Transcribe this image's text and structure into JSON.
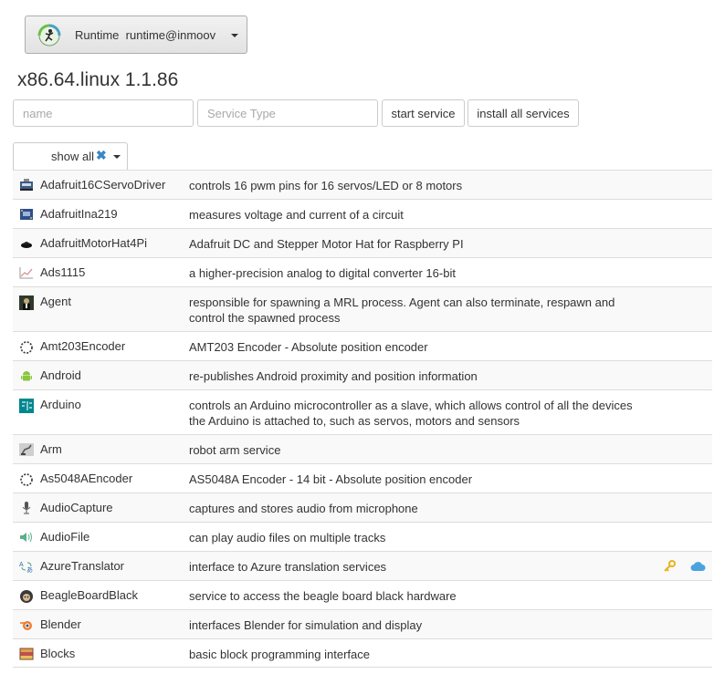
{
  "runtime": {
    "label": "Runtime",
    "instance": "runtime@inmoov",
    "logo_icon": "runtime-logo-icon"
  },
  "platform": "x86.64.linux 1.1.86",
  "filters": {
    "name_placeholder": "name",
    "type_placeholder": "Service Type",
    "start_label": "start service",
    "install_label": "install all services",
    "show_label": "show all",
    "clear_symbol": "✖"
  },
  "colors": {
    "accent_blue": "#3a87c8",
    "key_gold": "#e8b21a",
    "cloud_blue": "#4aa3df",
    "row_border": "#dddddd",
    "row_shade": "#f9f9f9"
  },
  "services": [
    {
      "name": "Adafruit16CServoDriver",
      "description": "controls 16 pwm pins for 16 servos/LED or 8 motors",
      "icon": "servo-driver-board-icon"
    },
    {
      "name": "AdafruitIna219",
      "description": "measures voltage and current of a circuit",
      "icon": "ina219-board-icon"
    },
    {
      "name": "AdafruitMotorHat4Pi",
      "description": "Adafruit DC and Stepper Motor Hat for Raspberry PI",
      "icon": "motor-hat-icon"
    },
    {
      "name": "Ads1115",
      "description": "a higher-precision analog to digital converter 16-bit",
      "icon": "analog-chart-icon"
    },
    {
      "name": "Agent",
      "description": "responsible for spawning a MRL process. Agent can also terminate, respawn and control the spawned process",
      "icon": "agent-icon"
    },
    {
      "name": "Amt203Encoder",
      "description": "AMT203 Encoder - Absolute position encoder",
      "icon": "encoder-ring-icon"
    },
    {
      "name": "Android",
      "description": "re-publishes Android proximity and position information",
      "icon": "android-icon"
    },
    {
      "name": "Arduino",
      "description": "controls an Arduino microcontroller as a slave, which allows control of all the devices the Arduino is attached to, such as servos, motors and sensors",
      "icon": "arduino-icon"
    },
    {
      "name": "Arm",
      "description": "robot arm service",
      "icon": "robot-arm-icon"
    },
    {
      "name": "As5048AEncoder",
      "description": "AS5048A Encoder - 14 bit - Absolute position encoder",
      "icon": "encoder-ring-icon"
    },
    {
      "name": "AudioCapture",
      "description": "captures and stores audio from microphone",
      "icon": "microphone-icon"
    },
    {
      "name": "AudioFile",
      "description": "can play audio files on multiple tracks",
      "icon": "speaker-icon"
    },
    {
      "name": "AzureTranslator",
      "description": "interface to Azure translation services",
      "icon": "translate-icon",
      "requires_key": true,
      "cloud": true
    },
    {
      "name": "BeagleBoardBlack",
      "description": "service to access the beagle board black hardware",
      "icon": "beagle-icon"
    },
    {
      "name": "Blender",
      "description": "interfaces Blender for simulation and display",
      "icon": "blender-icon"
    },
    {
      "name": "Blocks",
      "description": "basic block programming interface",
      "icon": "blocks-icon"
    }
  ]
}
